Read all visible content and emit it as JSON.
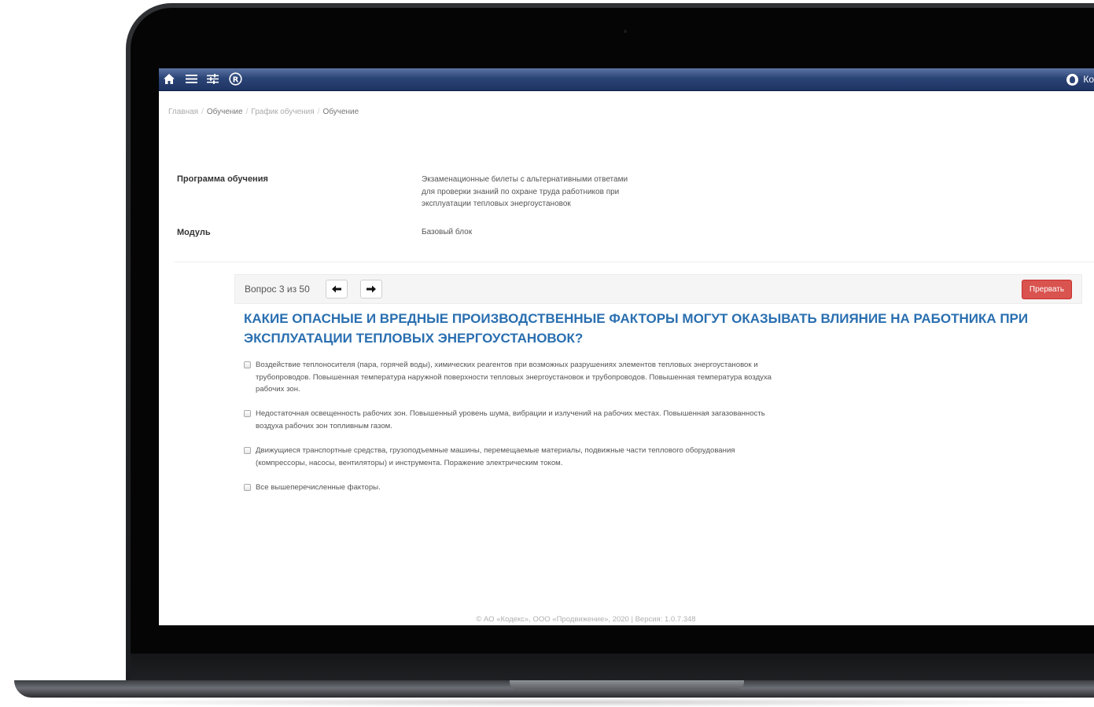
{
  "topbar": {
    "icons": [
      "home-icon",
      "menu-icon",
      "sliders-icon",
      "registered-icon"
    ],
    "user_name": "Ко"
  },
  "breadcrumb": {
    "items": [
      "Главная",
      "Обучение",
      "График обучения",
      "Обучение"
    ]
  },
  "info": {
    "program_label": "Программа обучения",
    "program_value_lines": [
      "Экзаменационные билеты с альтернативными ответами",
      "для проверки знаний по охране труда работников при",
      "эксплуатации тепловых энергоустановок"
    ],
    "module_label": "Модуль",
    "module_value": "Базовый блок"
  },
  "quiz": {
    "counter": "Вопрос 3 из 50",
    "prev_icon": "arrow-left-icon",
    "next_icon": "arrow-right-icon",
    "stop_label": "Прервать",
    "question": "КАКИЕ ОПАСНЫЕ И ВРЕДНЫЕ ПРОИЗВОДСТВЕННЫЕ ФАКТОРЫ МОГУТ ОКАЗЫВАТЬ ВЛИЯНИЕ НА РАБОТНИКА ПРИ ЭКСПЛУАТАЦИИ ТЕПЛОВЫХ ЭНЕРГОУСТАНОВОК?",
    "answers": [
      {
        "lines": [
          "Воздействие теплоносителя (пара, горячей воды), химических реагентов при возможных разрушениях элементов тепловых энергоустановок и",
          "трубопроводов. Повышенная температура наружной поверхности тепловых энергоустановок и трубопроводов. Повышенная температура воздуха",
          "рабочих зон."
        ],
        "checked": false
      },
      {
        "lines": [
          "Недостаточная освещенность рабочих зон. Повышенный уровень шума, вибрации и излучений на рабочих местах. Повышенная загазованность",
          "воздуха рабочих зон топливным газом."
        ],
        "checked": false
      },
      {
        "lines": [
          "Движущиеся транспортные средства, грузоподъемные машины, перемещаемые материалы, подвижные части теплового оборудования",
          "(компрессоры, насосы, вентиляторы) и инструмента. Поражение электрическим током."
        ],
        "checked": false
      },
      {
        "lines": [
          "Все вышеперечисленные факторы."
        ],
        "checked": false
      }
    ]
  },
  "footer": {
    "text": "© АО «Кодекс», ООО «Продвижение», 2020 | Версия: 1.0.7.348"
  }
}
